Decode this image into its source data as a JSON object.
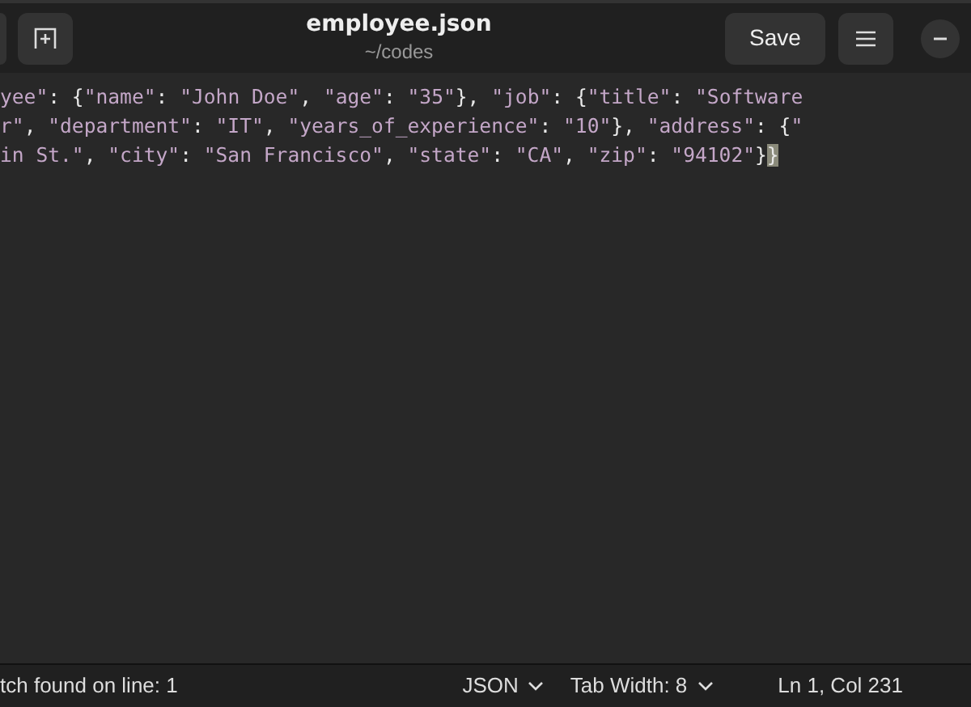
{
  "header": {
    "title": "employee.json",
    "subtitle": "~/codes",
    "save_label": "Save"
  },
  "lines": [
    [
      {
        "text": "yee\"",
        "kind": "string"
      },
      {
        "text": ": {",
        "kind": "punct"
      },
      {
        "text": "\"name\"",
        "kind": "string"
      },
      {
        "text": ": ",
        "kind": "punct"
      },
      {
        "text": "\"John Doe\"",
        "kind": "string"
      },
      {
        "text": ", ",
        "kind": "punct"
      },
      {
        "text": "\"age\"",
        "kind": "string"
      },
      {
        "text": ": ",
        "kind": "punct"
      },
      {
        "text": "\"35\"",
        "kind": "string"
      },
      {
        "text": "}, ",
        "kind": "punct"
      },
      {
        "text": "\"job\"",
        "kind": "string"
      },
      {
        "text": ": {",
        "kind": "punct"
      },
      {
        "text": "\"title\"",
        "kind": "string"
      },
      {
        "text": ": ",
        "kind": "punct"
      },
      {
        "text": "\"Software",
        "kind": "string"
      }
    ],
    [
      {
        "text": "r\"",
        "kind": "string"
      },
      {
        "text": ", ",
        "kind": "punct"
      },
      {
        "text": "\"department\"",
        "kind": "string"
      },
      {
        "text": ": ",
        "kind": "punct"
      },
      {
        "text": "\"IT\"",
        "kind": "string"
      },
      {
        "text": ", ",
        "kind": "punct"
      },
      {
        "text": "\"years_of_experience\"",
        "kind": "string"
      },
      {
        "text": ": ",
        "kind": "punct"
      },
      {
        "text": "\"10\"",
        "kind": "string"
      },
      {
        "text": "}, ",
        "kind": "punct"
      },
      {
        "text": "\"address\"",
        "kind": "string"
      },
      {
        "text": ": {",
        "kind": "punct"
      },
      {
        "text": "\"",
        "kind": "string"
      }
    ],
    [
      {
        "text": "in St.\"",
        "kind": "string"
      },
      {
        "text": ", ",
        "kind": "punct"
      },
      {
        "text": "\"city\"",
        "kind": "string"
      },
      {
        "text": ": ",
        "kind": "punct"
      },
      {
        "text": "\"San Francisco\"",
        "kind": "string"
      },
      {
        "text": ", ",
        "kind": "punct"
      },
      {
        "text": "\"state\"",
        "kind": "string"
      },
      {
        "text": ": ",
        "kind": "punct"
      },
      {
        "text": "\"CA\"",
        "kind": "string"
      },
      {
        "text": ", ",
        "kind": "punct"
      },
      {
        "text": "\"zip\"",
        "kind": "string"
      },
      {
        "text": ": ",
        "kind": "punct"
      },
      {
        "text": "\"94102\"",
        "kind": "string"
      },
      {
        "text": "}",
        "kind": "punct"
      },
      {
        "text": "}",
        "kind": "match"
      }
    ]
  ],
  "status_bar": {
    "message": "tch found on line: 1",
    "language": "JSON",
    "tab_width": "Tab Width: 8",
    "position": "Ln 1, Col 231"
  }
}
